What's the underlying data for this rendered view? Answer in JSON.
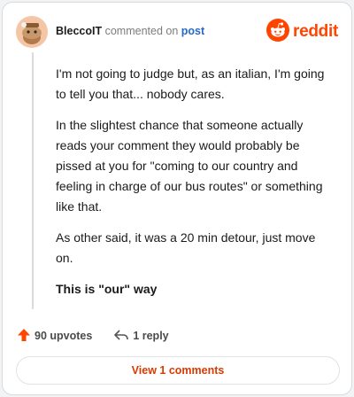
{
  "header": {
    "username": "BleccoIT",
    "verb": "commented on",
    "link": "post",
    "brand": "reddit"
  },
  "comment": {
    "paragraphs": [
      "I'm not going to judge but, as an italian, I'm going to tell you that... nobody cares.",
      "In the slightest chance that someone actually reads your comment they would probably be pissed at you for \"coming to our country and feeling in charge of our bus routes\" or something like that.",
      "As other said, it was a 20 min detour, just move on.",
      "This is \"our\" way"
    ]
  },
  "actions": {
    "upvotes": "90 upvotes",
    "replies": "1 reply"
  },
  "footer": {
    "view_label": "View 1 comments"
  },
  "colors": {
    "accent": "#ff4500",
    "link": "#2768c9",
    "view": "#d93a00"
  },
  "icons": [
    "avatar",
    "reddit-logo-icon",
    "upvote-arrow-icon",
    "reply-arrow-icon"
  ]
}
